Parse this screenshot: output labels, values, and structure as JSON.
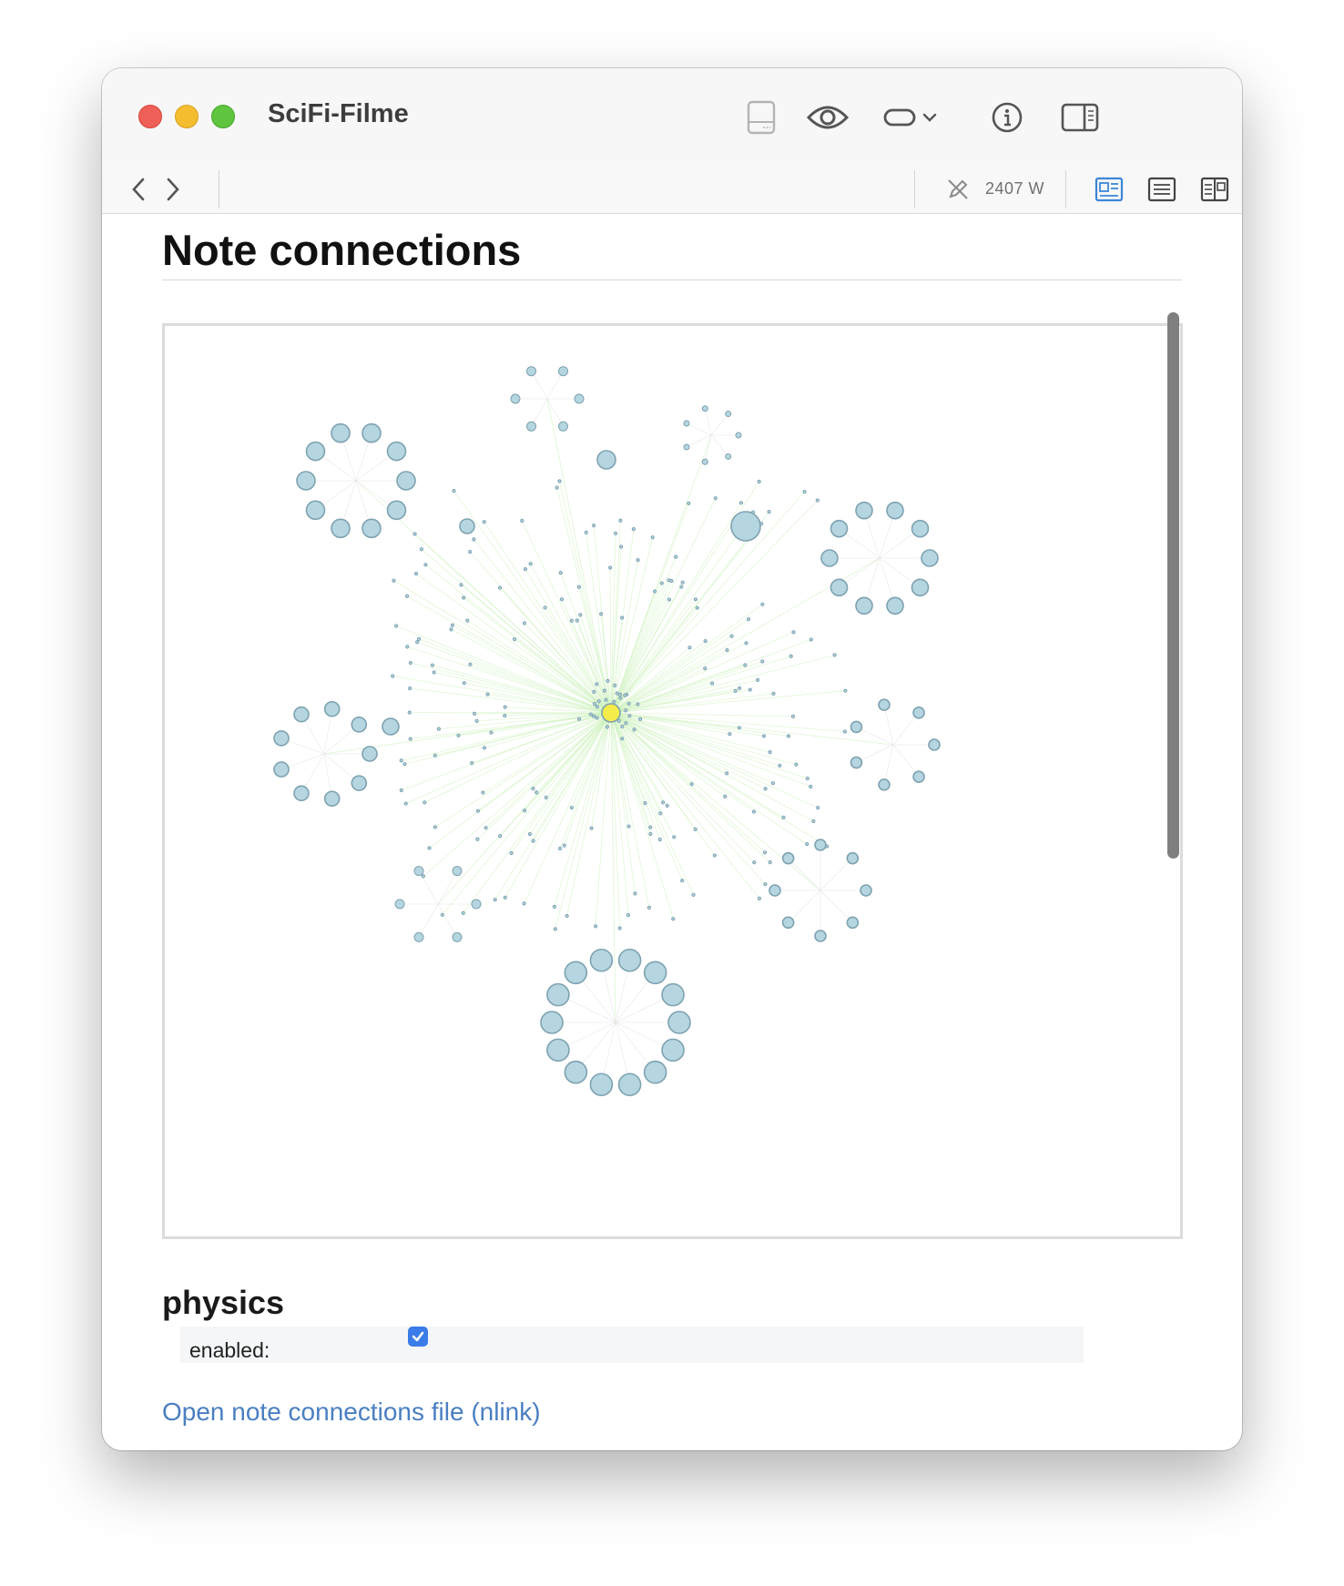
{
  "window": {
    "title": "SciFi-Filme",
    "toolbar_icons": [
      "sidebar-bottom-icon",
      "eye-icon",
      "toggle-pill-icon",
      "chevron-down-icon",
      "info-icon",
      "sidebar-right-icon"
    ]
  },
  "toolbar2": {
    "word_count": "2407 W",
    "nav_icons": [
      "chevron-left-icon",
      "chevron-right-icon"
    ],
    "view_icons": [
      "view-preview-icon",
      "view-text-icon",
      "view-split-icon"
    ]
  },
  "content": {
    "heading": "Note connections",
    "physics_heading": "physics",
    "enabled_label": "enabled:",
    "enabled_checked": true,
    "link_text": "Open note connections file (nlink)"
  },
  "colors": {
    "center_node": "#f5ed4a",
    "node_fill": "#b5d6e0",
    "node_stroke": "#7ea2b1",
    "edge_color": "#c7f0b4",
    "link": "#4a7fc1",
    "accent": "#3a7ce8"
  }
}
